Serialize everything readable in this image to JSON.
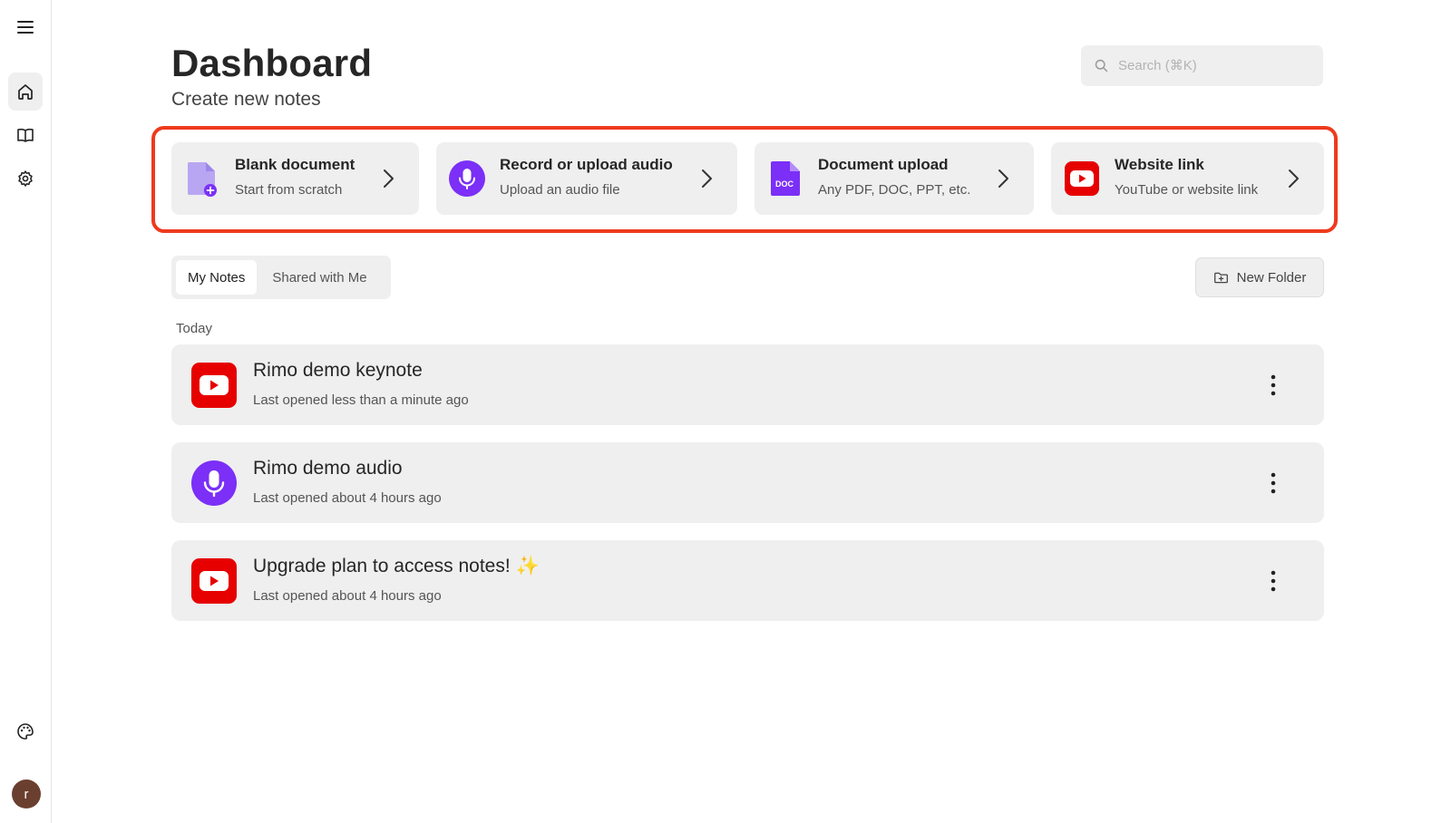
{
  "page": {
    "title": "Dashboard",
    "subtitle": "Create new notes"
  },
  "search": {
    "placeholder": "Search (⌘K)"
  },
  "sidebar": {
    "items": [
      {
        "name": "menu-icon"
      },
      {
        "name": "home-icon",
        "active": true
      },
      {
        "name": "book-icon"
      },
      {
        "name": "settings-icon"
      },
      {
        "name": "palette-icon"
      }
    ],
    "avatar_initial": "r"
  },
  "create_cards": [
    {
      "title": "Blank document",
      "subtitle": "Start from scratch",
      "icon": "blank-document-icon"
    },
    {
      "title": "Record or upload audio",
      "subtitle": "Upload an audio file",
      "icon": "microphone-icon"
    },
    {
      "title": "Document upload",
      "subtitle": "Any PDF, DOC, PPT, etc.",
      "icon": "doc-file-icon",
      "icon_text": "DOC"
    },
    {
      "title": "Website link",
      "subtitle": "YouTube or website link",
      "icon": "youtube-icon"
    }
  ],
  "tabs": [
    {
      "label": "My Notes",
      "active": true
    },
    {
      "label": "Shared with Me",
      "active": false
    }
  ],
  "new_folder_label": "New Folder",
  "section_label": "Today",
  "notes": [
    {
      "title": "Rimo demo keynote",
      "subtitle": "Last opened less than a minute ago",
      "icon": "youtube-icon"
    },
    {
      "title": "Rimo demo audio",
      "subtitle": "Last opened about 4 hours ago",
      "icon": "microphone-icon"
    },
    {
      "title": "Upgrade plan to access notes! ✨",
      "subtitle": "Last opened about 4 hours ago",
      "icon": "youtube-icon"
    }
  ],
  "colors": {
    "accent_purple": "#7b2ff7",
    "youtube_red": "#e60000",
    "highlight_red": "#ee3a1d",
    "card_bg": "#efefef"
  }
}
